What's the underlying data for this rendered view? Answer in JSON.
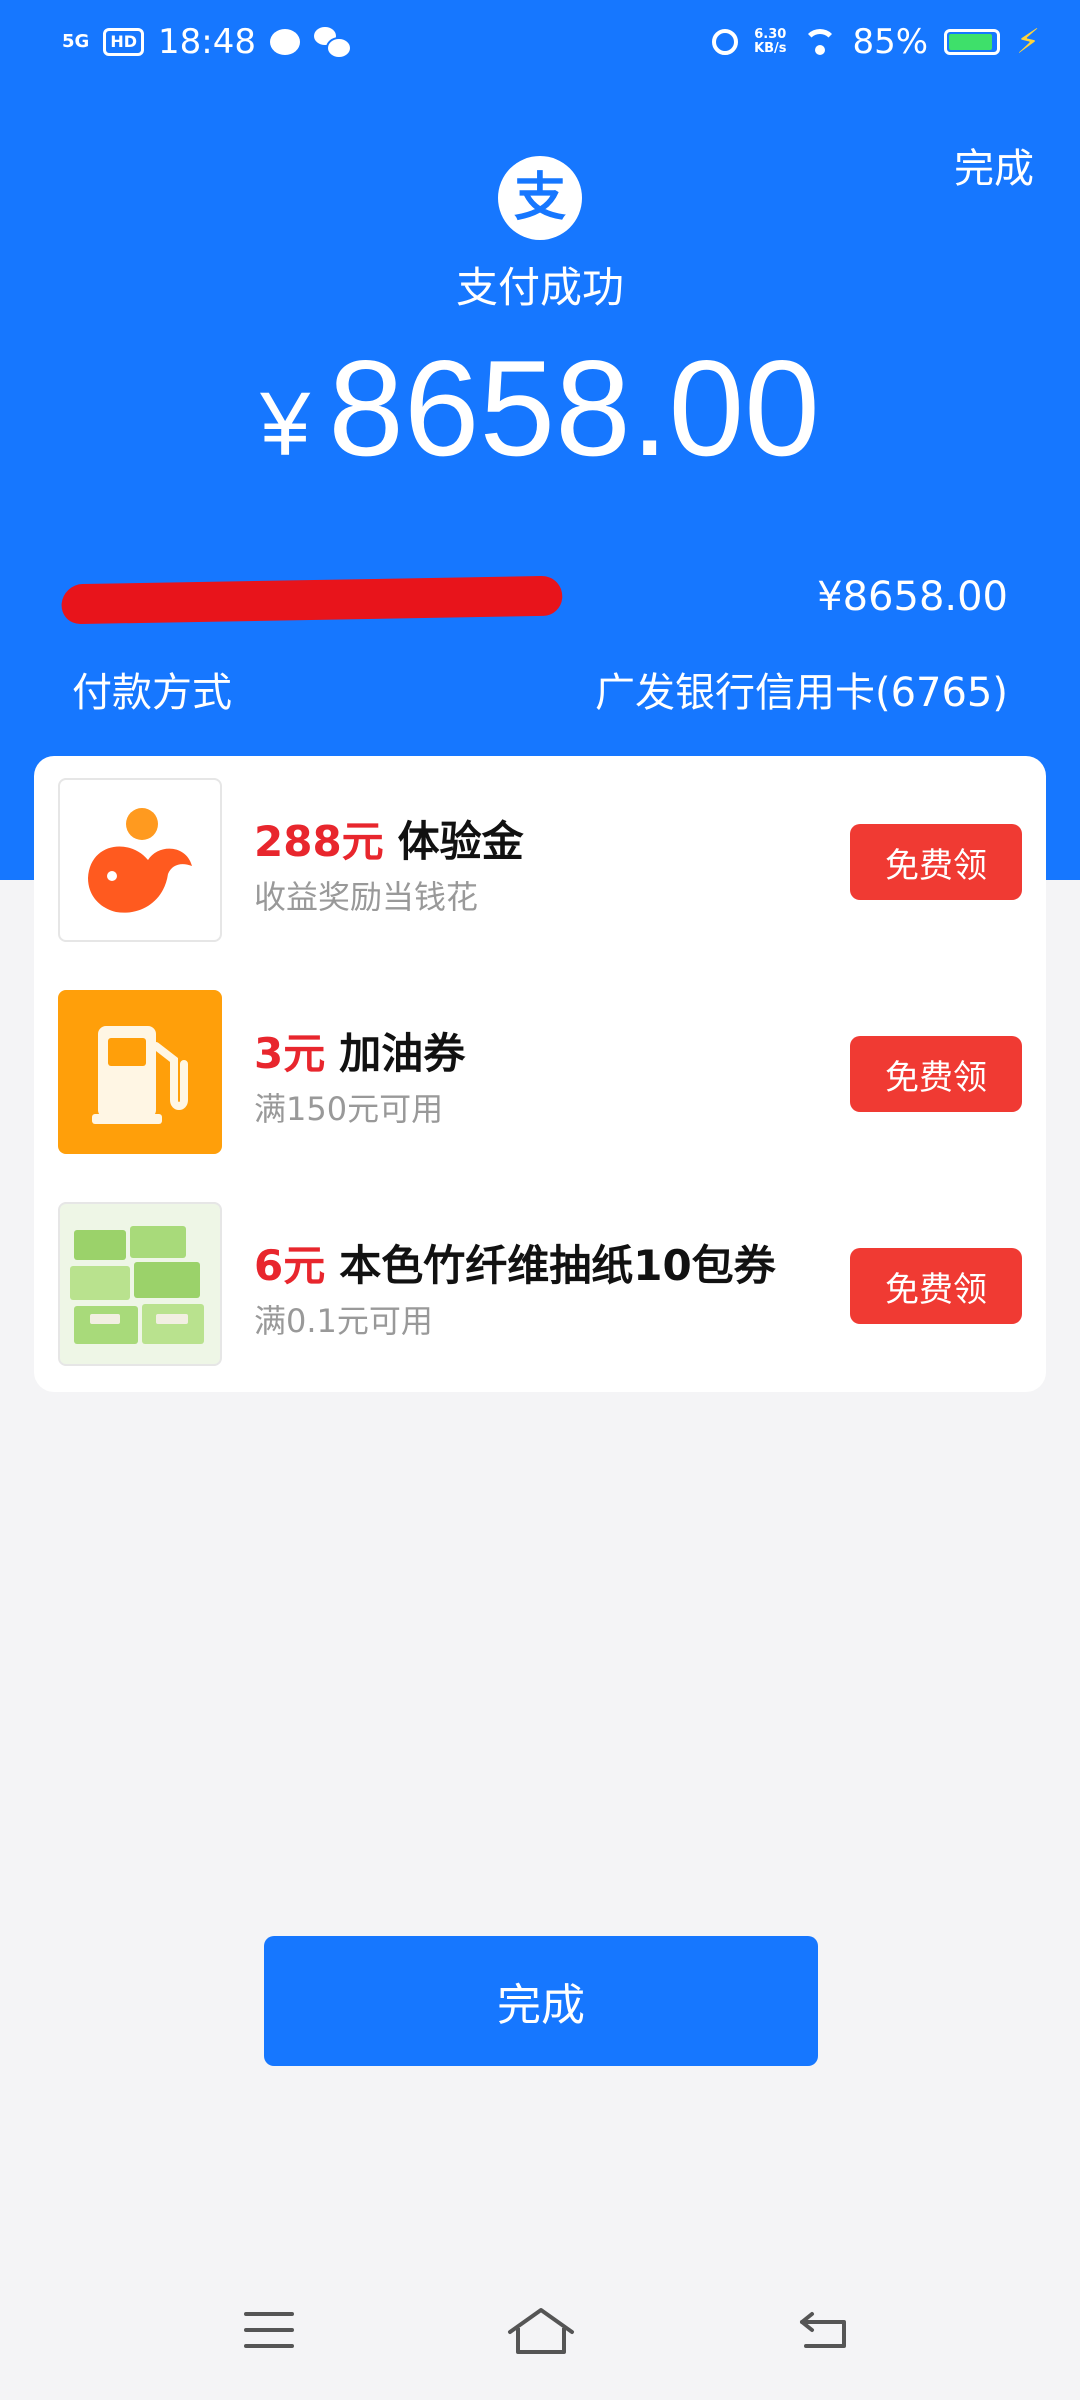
{
  "status_bar": {
    "signal": "5G",
    "hd": "HD",
    "time": "18:48",
    "net_speed_value": "6.30",
    "net_speed_unit": "KB/s",
    "battery": "85%"
  },
  "header": {
    "done_label": "完成",
    "logo_char": "支",
    "title": "支付成功",
    "currency": "¥",
    "amount": "8658.00"
  },
  "summary": {
    "amount_row_value": "¥8658.00",
    "payment_method_label": "付款方式",
    "payment_method_value": "广发银行信用卡(6765)"
  },
  "offers": [
    {
      "price": "288元",
      "name": "体验金",
      "desc": "收益奖励当钱花",
      "button": "免费领",
      "icon": "orange-whale-icon"
    },
    {
      "price": "3元",
      "name": "加油券",
      "desc": "满150元可用",
      "button": "免费领",
      "icon": "fuel-pump-icon"
    },
    {
      "price": "6元",
      "name": "本色竹纤维抽纸10包券",
      "desc": "满0.1元可用",
      "button": "免费领",
      "icon": "tissue-pack-icon"
    }
  ],
  "footer": {
    "done_label": "完成"
  },
  "colors": {
    "brand_blue": "#1677ff",
    "offer_red": "#e8262d",
    "claim_button": "#f03a33"
  }
}
